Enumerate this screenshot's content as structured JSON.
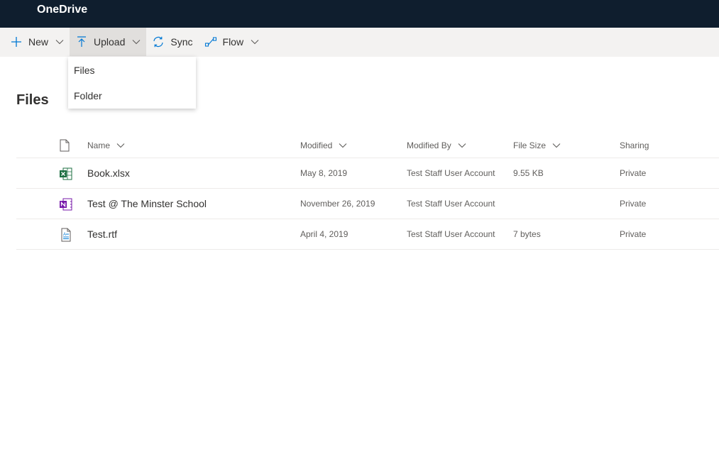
{
  "app": {
    "title": "OneDrive"
  },
  "commandbar": {
    "items": [
      {
        "label": "New",
        "icon": "plus-icon",
        "has_chevron": true
      },
      {
        "label": "Upload",
        "icon": "upload-icon",
        "has_chevron": true,
        "active": true
      },
      {
        "label": "Sync",
        "icon": "sync-icon",
        "has_chevron": false
      },
      {
        "label": "Flow",
        "icon": "flow-icon",
        "has_chevron": true
      }
    ]
  },
  "upload_menu": {
    "items": [
      {
        "label": "Files"
      },
      {
        "label": "Folder"
      }
    ]
  },
  "page": {
    "title": "Files"
  },
  "table": {
    "columns": {
      "type_icon": "document-icon",
      "name": "Name",
      "modified": "Modified",
      "modified_by": "Modified By",
      "file_size": "File Size",
      "sharing": "Sharing"
    },
    "rows": [
      {
        "icon": "excel-file-icon",
        "name": "Book.xlsx",
        "modified": "May 8, 2019",
        "modified_by": "Test Staff User Account",
        "file_size": "9.55 KB",
        "sharing": "Private"
      },
      {
        "icon": "onenote-file-icon",
        "name": "Test @ The Minster School",
        "modified": "November 26, 2019",
        "modified_by": "Test Staff User Account",
        "file_size": "",
        "sharing": "Private"
      },
      {
        "icon": "rtf-file-icon",
        "name": "Test.rtf",
        "modified": "April 4, 2019",
        "modified_by": "Test Staff User Account",
        "file_size": "7 bytes",
        "sharing": "Private"
      }
    ]
  },
  "colors": {
    "topbar": "#0f1e2e",
    "commandbar": "#f3f2f1",
    "accent": "#0078d4",
    "excel": "#1d6f42",
    "onenote": "#7719aa"
  }
}
